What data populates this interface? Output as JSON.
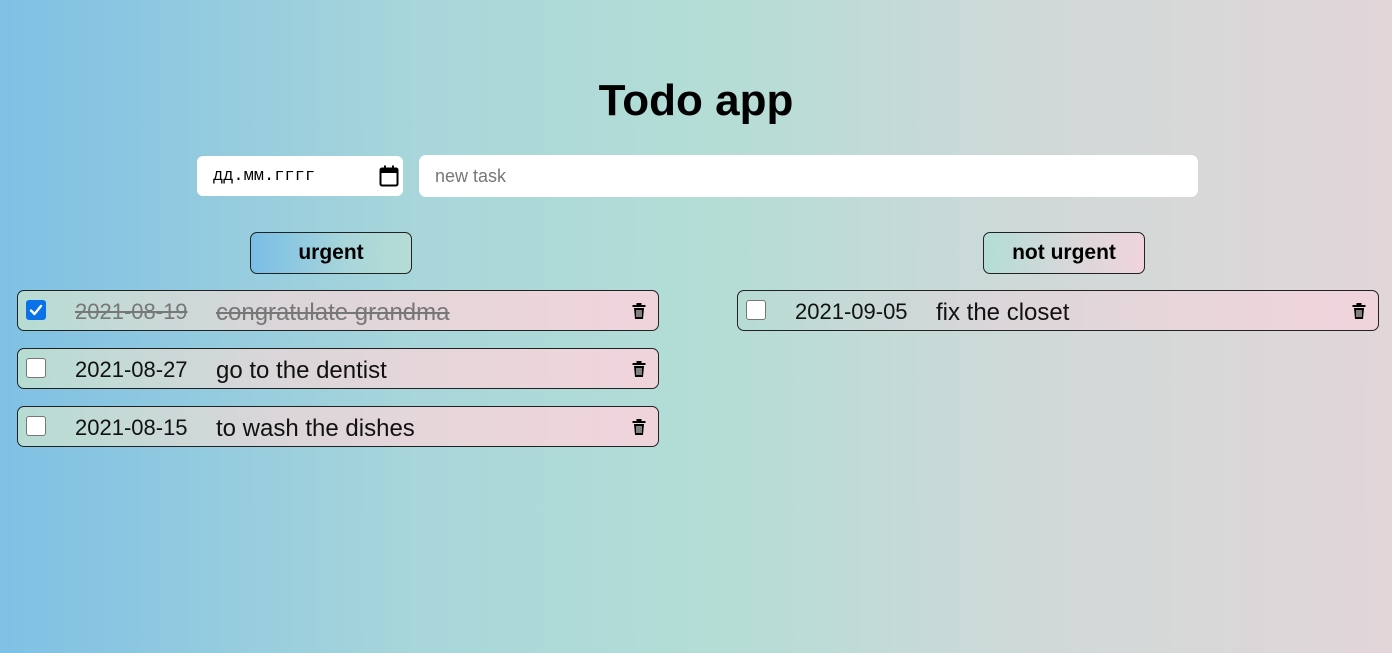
{
  "app": {
    "title": "Todo app"
  },
  "form": {
    "date_placeholder": "дд.мм.гггг",
    "task_placeholder": "new task"
  },
  "categories": {
    "urgent": {
      "label": "urgent"
    },
    "not_urgent": {
      "label": "not urgent"
    }
  },
  "urgent_tasks": [
    {
      "date": "2021-08-19",
      "text": "congratulate grandma",
      "done": true
    },
    {
      "date": "2021-08-27",
      "text": "go to the dentist",
      "done": false
    },
    {
      "date": "2021-08-15",
      "text": "to wash the dishes",
      "done": false
    }
  ],
  "not_urgent_tasks": [
    {
      "date": "2021-09-05",
      "text": "fix the closet",
      "done": false
    }
  ],
  "colors": {
    "checkbox_checked": "#0b71e8",
    "bg_left": "#7fc0e4",
    "bg_right": "#e2d6d9"
  },
  "icons": {
    "calendar": "calendar-icon",
    "delete": "trash-icon",
    "check": "check-icon"
  }
}
